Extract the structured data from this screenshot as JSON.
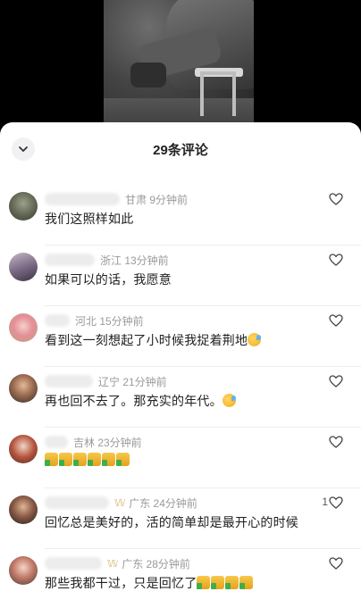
{
  "sheet": {
    "title": "29条评论"
  },
  "icons": {
    "collapse": "chevron-down-icon",
    "like": "heart-outline-icon"
  },
  "colors": {
    "sheet_bg": "#ffffff",
    "meta_text": "#9a9a9a",
    "body_text": "#1f1f1f",
    "divider": "#ededed"
  },
  "comments": [
    {
      "meta": "甘肃 9分钟前",
      "text": "我们这照样如此",
      "emoji": [],
      "likes": ""
    },
    {
      "meta": "浙江 13分钟前",
      "text": "如果可以的话，我愿意",
      "emoji": [],
      "likes": ""
    },
    {
      "meta": "河北 15分钟前",
      "text": "看到这一刻想起了小时候我捉着荆地",
      "emoji": [
        "sweat-smile-emoji"
      ],
      "likes": ""
    },
    {
      "meta": "辽宁 21分钟前",
      "text": "再也回不去了。那充实的年代。",
      "emoji": [
        "sweat-smile-emoji"
      ],
      "likes": ""
    },
    {
      "meta": "吉林 23分钟前",
      "text": "",
      "emoji": [
        "thumbs-up-emoji",
        "thumbs-up-emoji",
        "thumbs-up-emoji",
        "thumbs-up-emoji",
        "thumbs-up-emoji",
        "thumbs-up-emoji"
      ],
      "likes": ""
    },
    {
      "meta": "广东 24分钟前",
      "text": "回忆总是美好的，活的简单却是最开心的时候",
      "emoji": [],
      "likes": "1",
      "crown": true
    },
    {
      "meta": "广东 28分钟前",
      "text": "那些我都干过，只是回忆了",
      "emoji": [
        "thumbs-up-emoji",
        "thumbs-up-emoji",
        "thumbs-up-emoji",
        "thumbs-up-emoji"
      ],
      "likes": "",
      "crown": true
    }
  ]
}
